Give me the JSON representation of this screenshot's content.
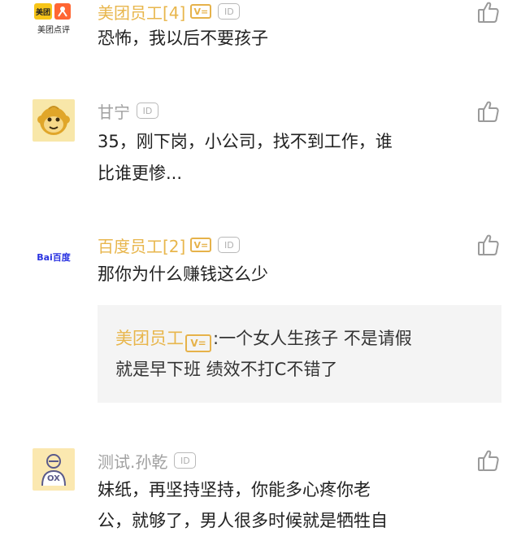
{
  "comments": [
    {
      "avatar_label_top": "美团",
      "avatar_label_bottom": "美团点评",
      "name": "美团员工[4]",
      "verified_badge": "V=",
      "id_badge": "ID",
      "text": "恐怖，我以后不要孩子"
    },
    {
      "name": "甘宁",
      "id_badge": "ID",
      "text_line1": "35，刚下岗，小公司，找不到工作，谁",
      "text_line2": "比谁更惨..."
    },
    {
      "avatar_label": "Bai百度",
      "name": "百度员工[2]",
      "verified_badge": "V=",
      "id_badge": "ID",
      "text": "那你为什么赚钱这么少",
      "quote": {
        "name": "美团员工",
        "badge": "V=",
        "colon": ":",
        "text_line1": "一个女人生孩子 不是请假",
        "text_line2": "就是早下班  绩效不打C不错了"
      }
    },
    {
      "avatar_label": "OX",
      "name": "测试.孙乾",
      "id_badge": "ID",
      "text_line1": "妹纸，再坚持坚持，你能多心疼你老",
      "text_line2": "公，就够了，男人很多时候就是牺牲自"
    }
  ],
  "icons": {
    "like": "thumbs-up-icon"
  },
  "colors": {
    "name_gold": "#e8b64c",
    "name_gray": "#a0a0a0",
    "quote_bg": "#f4f4f4"
  }
}
